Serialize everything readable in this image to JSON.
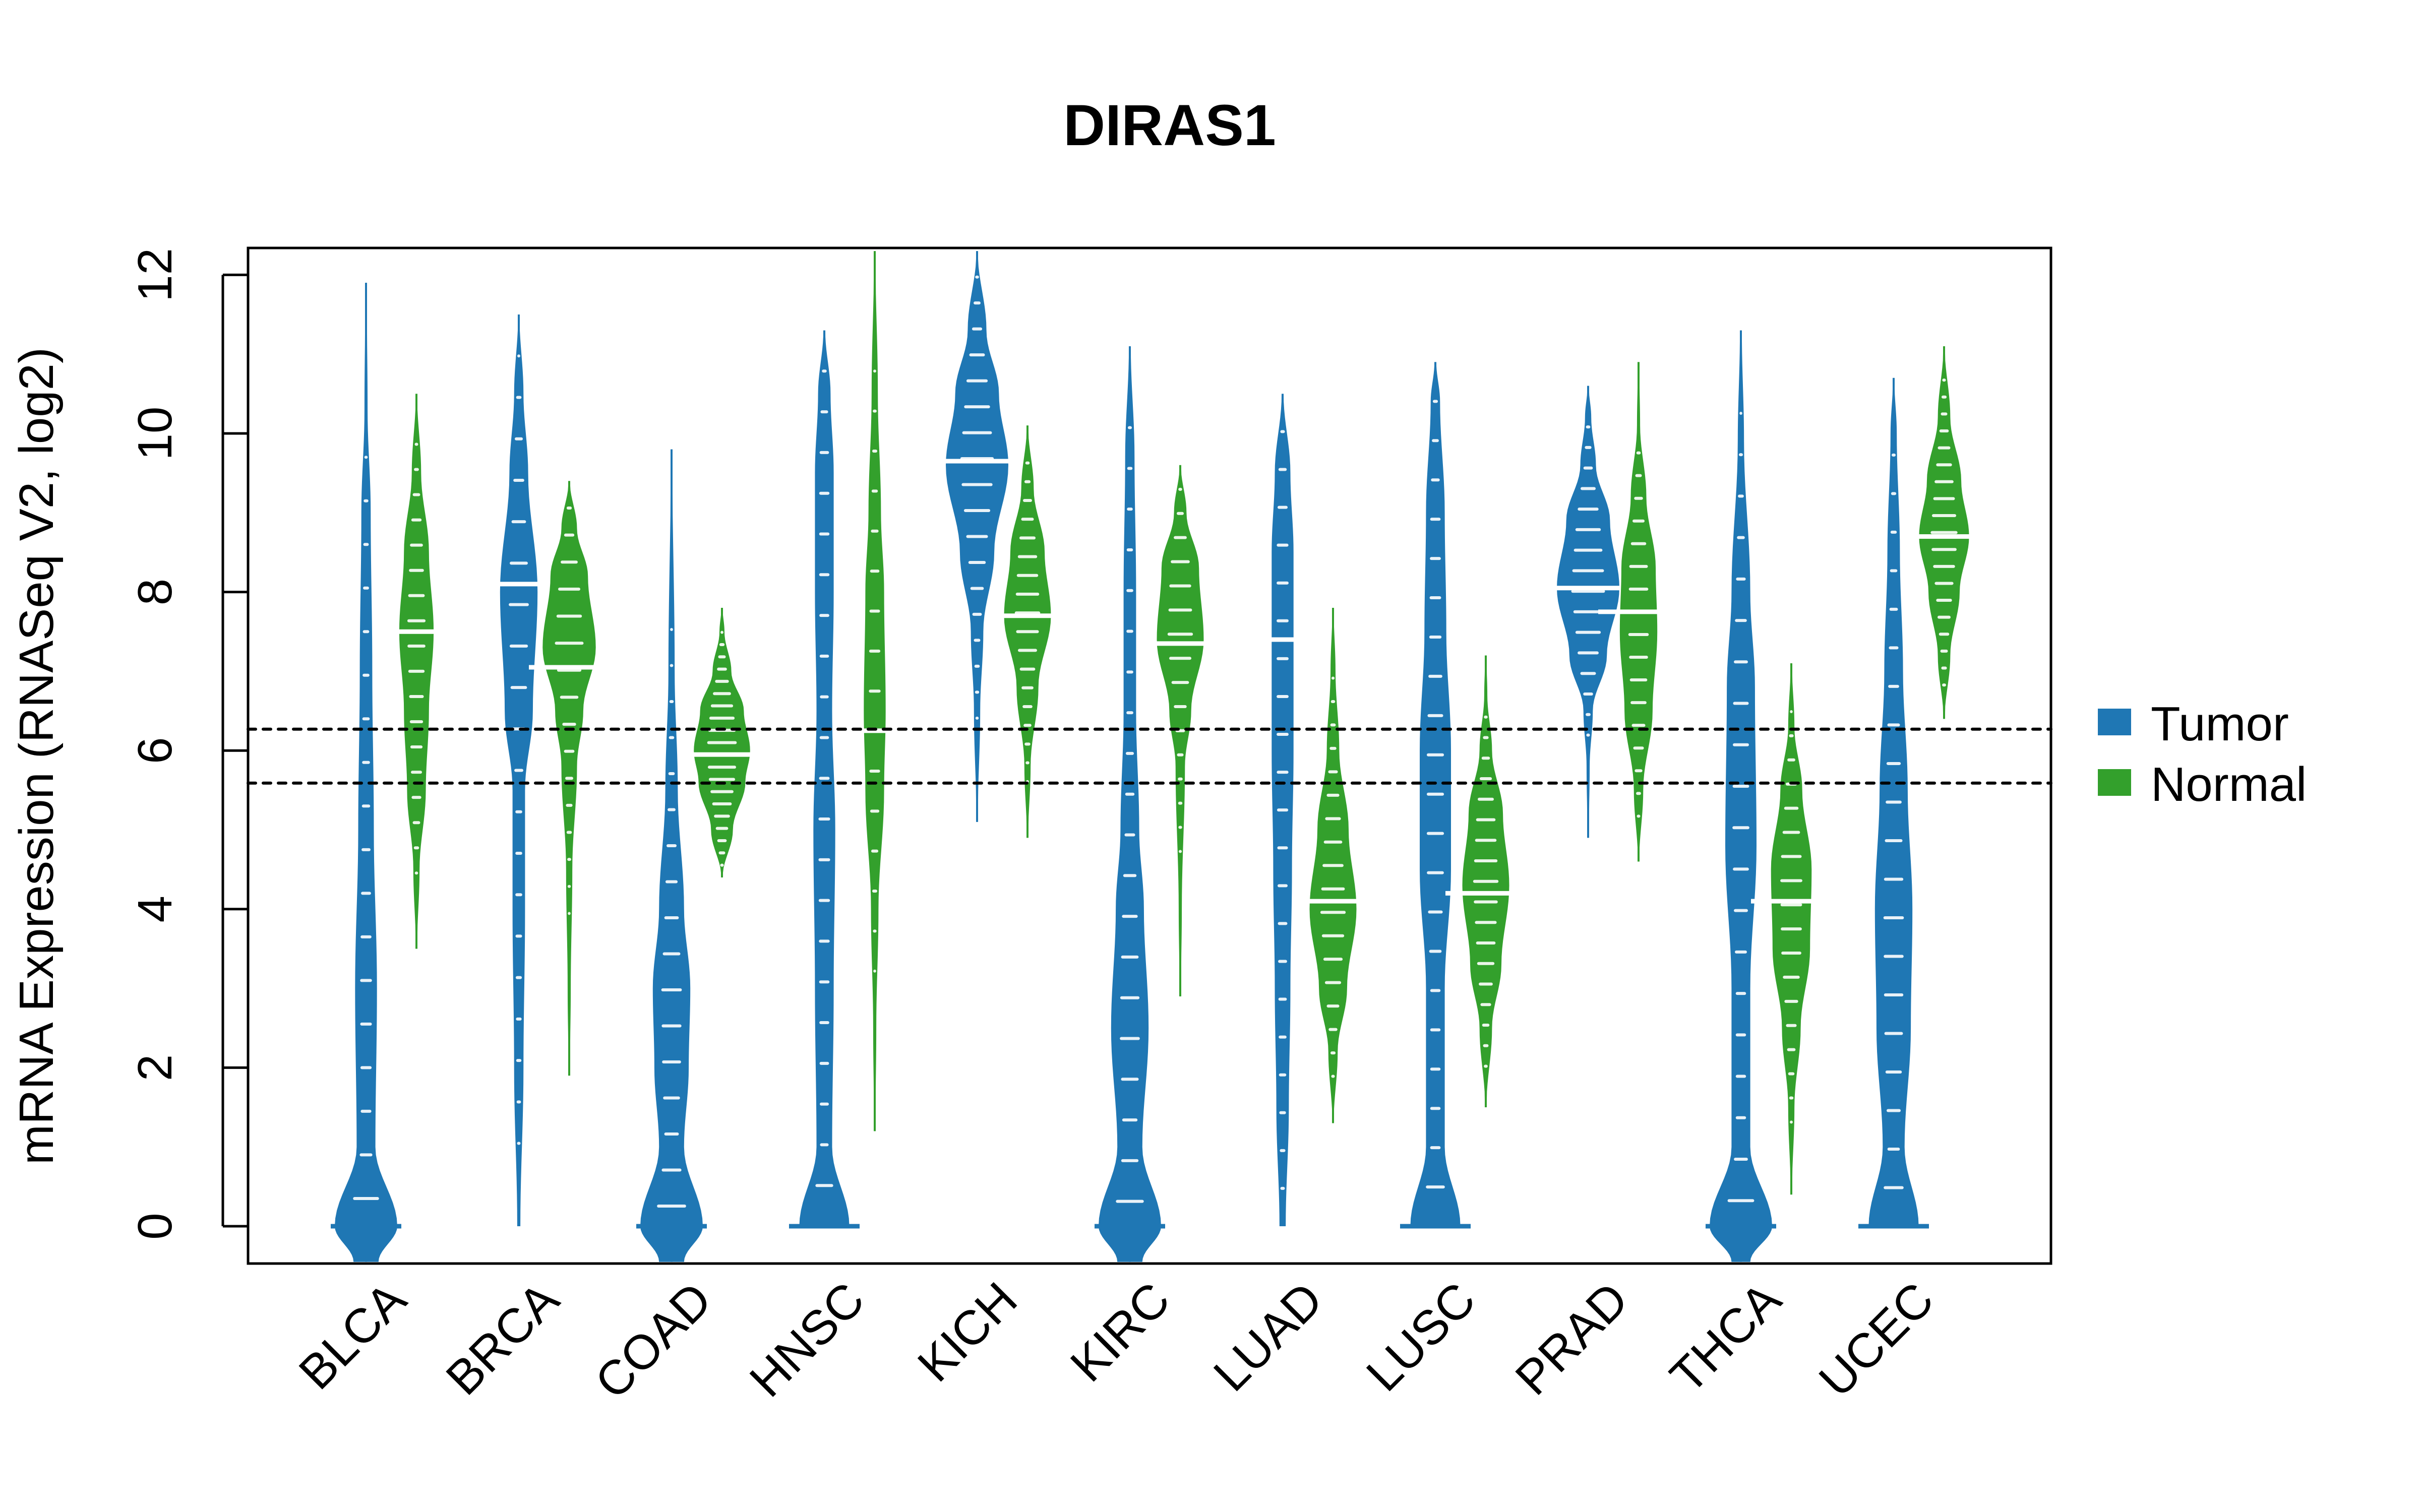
{
  "chart_data": {
    "type": "violin",
    "title": "DIRAS1",
    "xlabel": "",
    "ylabel": "mRNA Expression (RNASeq V2, log2)",
    "ylim": [
      -0.45,
      12.35
    ],
    "yticks": [
      0,
      2,
      4,
      6,
      8,
      10,
      12
    ],
    "grid": false,
    "legend": {
      "position": "right",
      "entries": [
        {
          "name": "Tumor",
          "color": "#1f77b4"
        },
        {
          "name": "Normal",
          "color": "#33a02c"
        }
      ]
    },
    "reference_lines": [
      {
        "value": 6.27,
        "style": "dotted"
      },
      {
        "value": 5.59,
        "style": "dotted"
      }
    ],
    "categories": [
      "BLCA",
      "BRCA",
      "COAD",
      "HNSC",
      "KICH",
      "KIRC",
      "LUAD",
      "LUSC",
      "PRAD",
      "THCA",
      "UCEC"
    ],
    "series": [
      {
        "name": "Tumor",
        "color": "#1f77b4",
        "values": [
          {
            "category": "BLCA",
            "min": -0.45,
            "max": 11.9,
            "median": 0.0,
            "zero_inflated": true,
            "profile": [
              [
                -0.45,
                0.4
              ],
              [
                0,
                1.0
              ],
              [
                1,
                0.3
              ],
              [
                3,
                0.35
              ],
              [
                5,
                0.25
              ],
              [
                7,
                0.2
              ],
              [
                9,
                0.15
              ],
              [
                10.3,
                0.05
              ],
              [
                11.9,
                0.02
              ]
            ]
          },
          {
            "category": "BRCA",
            "min": 0.0,
            "max": 11.5,
            "median": 8.1,
            "zero_inflated": false,
            "profile": [
              [
                0,
                0.05
              ],
              [
                2,
                0.15
              ],
              [
                4,
                0.2
              ],
              [
                5.5,
                0.2
              ],
              [
                6.5,
                0.45
              ],
              [
                8,
                0.6
              ],
              [
                9.5,
                0.3
              ],
              [
                10.5,
                0.15
              ],
              [
                11.5,
                0.02
              ]
            ]
          },
          {
            "category": "COAD",
            "min": -0.45,
            "max": 9.8,
            "median": 0.0,
            "zero_inflated": true,
            "profile": [
              [
                -0.45,
                0.4
              ],
              [
                0,
                1.0
              ],
              [
                1,
                0.4
              ],
              [
                2,
                0.55
              ],
              [
                3,
                0.6
              ],
              [
                4,
                0.4
              ],
              [
                5.5,
                0.2
              ],
              [
                7,
                0.1
              ],
              [
                9.8,
                0.02
              ]
            ]
          },
          {
            "category": "HNSC",
            "min": 0.0,
            "max": 11.3,
            "median": 0.0,
            "zero_inflated": true,
            "profile": [
              [
                0,
                0.8
              ],
              [
                1,
                0.25
              ],
              [
                3,
                0.3
              ],
              [
                5,
                0.35
              ],
              [
                6.5,
                0.25
              ],
              [
                8,
                0.3
              ],
              [
                9.5,
                0.3
              ],
              [
                10.5,
                0.2
              ],
              [
                11.3,
                0.03
              ]
            ]
          },
          {
            "category": "KICH",
            "min": 5.1,
            "max": 12.3,
            "median": 9.65,
            "zero_inflated": false,
            "profile": [
              [
                5.1,
                0.02
              ],
              [
                6.5,
                0.1
              ],
              [
                7.5,
                0.2
              ],
              [
                8.5,
                0.55
              ],
              [
                9.6,
                1.0
              ],
              [
                10.5,
                0.7
              ],
              [
                11.3,
                0.3
              ],
              [
                12.3,
                0.02
              ]
            ]
          },
          {
            "category": "KIRC",
            "min": -0.45,
            "max": 11.1,
            "median": 0.0,
            "zero_inflated": true,
            "profile": [
              [
                -0.45,
                0.4
              ],
              [
                0,
                1.0
              ],
              [
                1,
                0.4
              ],
              [
                2.5,
                0.6
              ],
              [
                4,
                0.45
              ],
              [
                5,
                0.3
              ],
              [
                6.5,
                0.2
              ],
              [
                8,
                0.2
              ],
              [
                9.7,
                0.15
              ],
              [
                11.1,
                0.03
              ]
            ]
          },
          {
            "category": "LUAD",
            "min": 0.0,
            "max": 10.5,
            "median": 7.4,
            "zero_inflated": false,
            "profile": [
              [
                0,
                0.1
              ],
              [
                1.5,
                0.2
              ],
              [
                3,
                0.25
              ],
              [
                4.5,
                0.3
              ],
              [
                6,
                0.35
              ],
              [
                7.4,
                0.35
              ],
              [
                8.5,
                0.35
              ],
              [
                9.5,
                0.25
              ],
              [
                10.5,
                0.03
              ]
            ]
          },
          {
            "category": "LUSC",
            "min": 0.0,
            "max": 10.9,
            "median": 0.0,
            "zero_inflated": true,
            "profile": [
              [
                0,
                0.8
              ],
              [
                1,
                0.3
              ],
              [
                3,
                0.3
              ],
              [
                4.5,
                0.5
              ],
              [
                6,
                0.5
              ],
              [
                7.5,
                0.35
              ],
              [
                9,
                0.3
              ],
              [
                10.4,
                0.15
              ],
              [
                10.9,
                0.03
              ]
            ]
          },
          {
            "category": "PRAD",
            "min": 4.9,
            "max": 10.6,
            "median": 8.05,
            "zero_inflated": false,
            "profile": [
              [
                4.9,
                0.02
              ],
              [
                5.8,
                0.05
              ],
              [
                6.5,
                0.15
              ],
              [
                7.2,
                0.6
              ],
              [
                8.05,
                1.0
              ],
              [
                8.9,
                0.7
              ],
              [
                9.6,
                0.25
              ],
              [
                10.2,
                0.1
              ],
              [
                10.6,
                0.02
              ]
            ]
          },
          {
            "category": "THCA",
            "min": -0.45,
            "max": 11.3,
            "median": 0.0,
            "zero_inflated": true,
            "profile": [
              [
                -0.45,
                0.3
              ],
              [
                0,
                1.0
              ],
              [
                1,
                0.3
              ],
              [
                3,
                0.3
              ],
              [
                4.8,
                0.5
              ],
              [
                6.8,
                0.45
              ],
              [
                8,
                0.3
              ],
              [
                9.9,
                0.1
              ],
              [
                11.3,
                0.03
              ]
            ]
          },
          {
            "category": "UCEC",
            "min": 0.0,
            "max": 10.7,
            "median": 0.0,
            "zero_inflated": true,
            "profile": [
              [
                0,
                0.8
              ],
              [
                1,
                0.35
              ],
              [
                2.5,
                0.55
              ],
              [
                4,
                0.6
              ],
              [
                5.5,
                0.45
              ],
              [
                7,
                0.3
              ],
              [
                8.5,
                0.2
              ],
              [
                10,
                0.1
              ],
              [
                10.7,
                0.02
              ]
            ]
          }
        ]
      },
      {
        "name": "Normal",
        "color": "#33a02c",
        "values": [
          {
            "category": "BLCA",
            "min": 3.5,
            "max": 10.5,
            "median": 7.5,
            "profile": [
              [
                3.5,
                0.02
              ],
              [
                4.5,
                0.1
              ],
              [
                5.5,
                0.3
              ],
              [
                6.5,
                0.4
              ],
              [
                7.5,
                0.55
              ],
              [
                8.5,
                0.4
              ],
              [
                9.5,
                0.15
              ],
              [
                10.5,
                0.02
              ]
            ]
          },
          {
            "category": "BRCA",
            "min": 1.9,
            "max": 9.4,
            "median": 7.05,
            "profile": [
              [
                1.9,
                0.02
              ],
              [
                3,
                0.05
              ],
              [
                4.5,
                0.1
              ],
              [
                5.8,
                0.25
              ],
              [
                6.5,
                0.45
              ],
              [
                7.3,
                0.85
              ],
              [
                8.2,
                0.6
              ],
              [
                8.8,
                0.25
              ],
              [
                9.4,
                0.02
              ]
            ]
          },
          {
            "category": "COAD",
            "min": 4.4,
            "max": 7.8,
            "median": 5.95,
            "profile": [
              [
                4.4,
                0.02
              ],
              [
                5,
                0.35
              ],
              [
                5.6,
                0.75
              ],
              [
                6.0,
                0.9
              ],
              [
                6.5,
                0.7
              ],
              [
                7,
                0.3
              ],
              [
                7.5,
                0.08
              ],
              [
                7.8,
                0.02
              ]
            ]
          },
          {
            "category": "HNSC",
            "min": 1.2,
            "max": 12.3,
            "median": 6.25,
            "profile": [
              [
                1.2,
                0.02
              ],
              [
                2.5,
                0.05
              ],
              [
                4,
                0.12
              ],
              [
                5.5,
                0.3
              ],
              [
                6.5,
                0.35
              ],
              [
                8,
                0.3
              ],
              [
                9,
                0.2
              ],
              [
                10.5,
                0.1
              ],
              [
                12.3,
                0.02
              ]
            ]
          },
          {
            "category": "KICH",
            "min": 4.9,
            "max": 10.1,
            "median": 7.7,
            "profile": [
              [
                4.9,
                0.02
              ],
              [
                5.8,
                0.1
              ],
              [
                6.8,
                0.35
              ],
              [
                7.7,
                0.75
              ],
              [
                8.5,
                0.55
              ],
              [
                9.3,
                0.2
              ],
              [
                10.1,
                0.02
              ]
            ]
          },
          {
            "category": "KIRC",
            "min": 2.9,
            "max": 9.6,
            "median": 7.35,
            "profile": [
              [
                2.9,
                0.02
              ],
              [
                4,
                0.05
              ],
              [
                5.8,
                0.15
              ],
              [
                6.5,
                0.35
              ],
              [
                7.4,
                0.75
              ],
              [
                8.3,
                0.6
              ],
              [
                9,
                0.2
              ],
              [
                9.6,
                0.02
              ]
            ]
          },
          {
            "category": "LUAD",
            "min": 1.3,
            "max": 7.8,
            "median": 4.1,
            "profile": [
              [
                1.3,
                0.02
              ],
              [
                2.2,
                0.15
              ],
              [
                3,
                0.45
              ],
              [
                4,
                0.75
              ],
              [
                5,
                0.5
              ],
              [
                6,
                0.2
              ],
              [
                7,
                0.08
              ],
              [
                7.8,
                0.02
              ]
            ]
          },
          {
            "category": "LUSC",
            "min": 1.5,
            "max": 7.2,
            "median": 4.2,
            "profile": [
              [
                1.5,
                0.02
              ],
              [
                2.5,
                0.2
              ],
              [
                3.3,
                0.5
              ],
              [
                4.3,
                0.75
              ],
              [
                5.2,
                0.55
              ],
              [
                6,
                0.2
              ],
              [
                6.7,
                0.05
              ],
              [
                7.2,
                0.02
              ]
            ]
          },
          {
            "category": "PRAD",
            "min": 4.6,
            "max": 10.9,
            "median": 7.75,
            "profile": [
              [
                4.6,
                0.02
              ],
              [
                5.5,
                0.15
              ],
              [
                6.5,
                0.45
              ],
              [
                7.5,
                0.6
              ],
              [
                8.3,
                0.55
              ],
              [
                9.2,
                0.25
              ],
              [
                10.1,
                0.05
              ],
              [
                10.9,
                0.02
              ]
            ]
          },
          {
            "category": "THCA",
            "min": 0.4,
            "max": 7.1,
            "median": 4.1,
            "profile": [
              [
                0.4,
                0.02
              ],
              [
                1.5,
                0.1
              ],
              [
                2.5,
                0.3
              ],
              [
                3.5,
                0.6
              ],
              [
                4.5,
                0.65
              ],
              [
                5.5,
                0.35
              ],
              [
                6.3,
                0.1
              ],
              [
                7.1,
                0.02
              ]
            ]
          },
          {
            "category": "UCEC",
            "min": 6.4,
            "max": 11.1,
            "median": 8.7,
            "profile": [
              [
                6.4,
                0.02
              ],
              [
                7.2,
                0.2
              ],
              [
                8,
                0.5
              ],
              [
                8.7,
                0.8
              ],
              [
                9.4,
                0.55
              ],
              [
                10.2,
                0.2
              ],
              [
                11.1,
                0.02
              ]
            ]
          }
        ]
      }
    ]
  }
}
